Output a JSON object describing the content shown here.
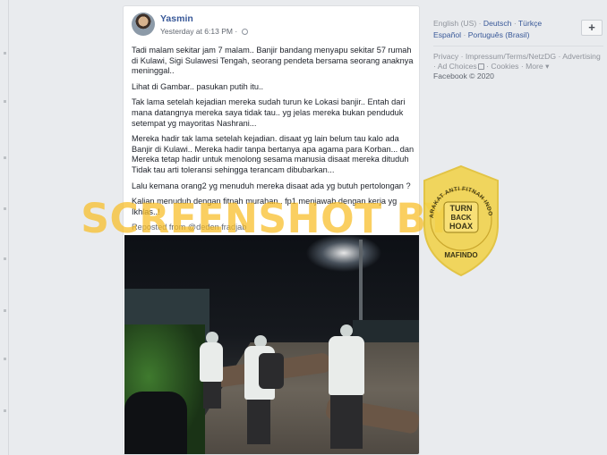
{
  "post": {
    "author": "Yasmin",
    "timestamp": "Yesterday at 6:13 PM",
    "privacy_icon": "globe-icon",
    "paragraphs": [
      "Tadi malam sekitar jam 7 malam.. Banjir bandang menyapu sekitar 57 rumah di Kulawi, Sigi Sulawesi Tengah, seorang pendeta bersama seorang anaknya meninggal..",
      "Lihat di Gambar.. pasukan putih itu..",
      "Tak lama setelah kejadian mereka sudah turun ke Lokasi banjir.. Entah dari mana datangnya mereka saya tidak tau.. yg jelas mereka bukan penduduk setempat yg mayoritas Nashrani...",
      "Mereka hadir tak lama setelah kejadian. disaat yg lain belum tau kalo ada Banjir di Kulawi.. Mereka hadir tanpa bertanya apa agama para Korban... dan Mereka tetap hadir untuk menolong sesama manusia disaat mereka dituduh Tidak tau arti toleransi sehingga terancam dibubarkan...",
      "Lalu kemana orang2 yg menuduh mereka disaat ada yg butuh pertolongan ?",
      "Kalian menuduh dengan fitnah murahan.. fp1 menjawab dengan kerja yg Ikhlas..!"
    ],
    "reposted": "Reposted from @deden fradjab"
  },
  "sidebar": {
    "languages": [
      "English (US)",
      "Deutsch",
      "Türkçe",
      "Español",
      "Português (Brasil)"
    ],
    "add_language": "+",
    "footer_links": [
      "Privacy",
      "Impressum/Terms/NetzDG",
      "Advertising",
      "Ad Choices",
      "Cookies",
      "More"
    ],
    "more_icon": "caret-down-icon",
    "copyright": "Facebook © 2020"
  },
  "watermark": {
    "text": "SCREENSHOT BY",
    "color": "#f8bc24"
  },
  "stamp": {
    "ring_text": "MASYARAKAT ANTI FITNAH INDONESIA",
    "center_lines": [
      "TURN",
      "BACK",
      "HOAX"
    ],
    "bottom_text": "MAFINDO",
    "color": "#f2d24a"
  },
  "colors": {
    "link": "#385898",
    "page_bg": "#e9ebee"
  }
}
